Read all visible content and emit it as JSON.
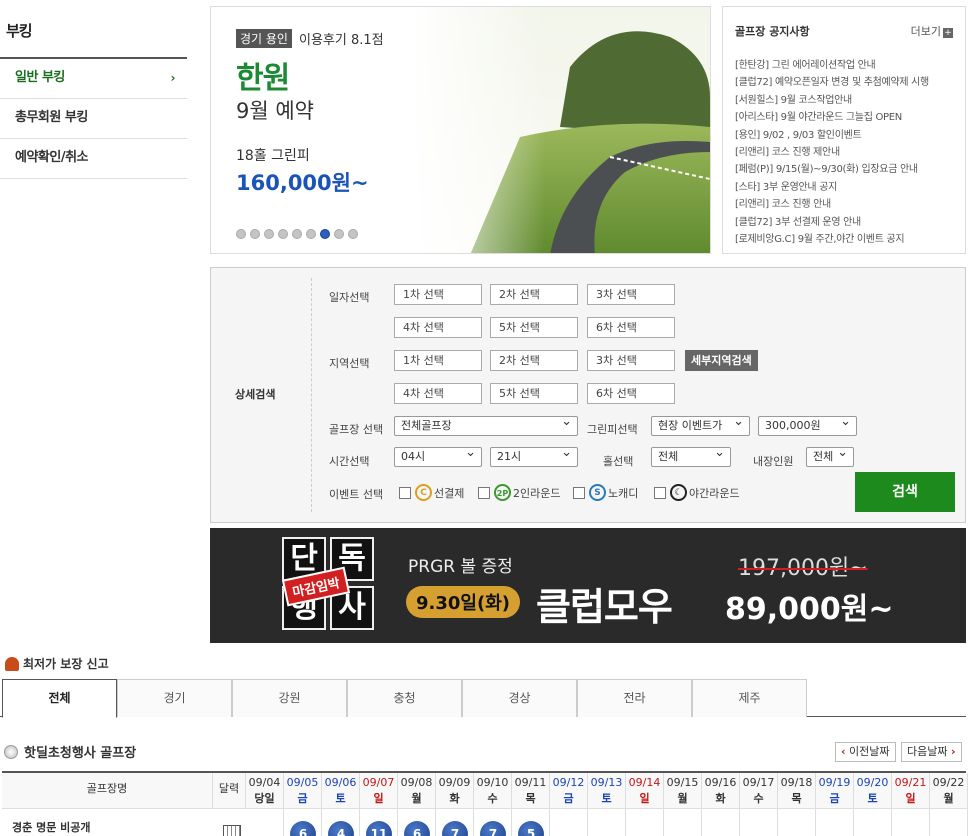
{
  "sidebar": {
    "title": "부킹",
    "items": [
      {
        "label": "일반 부킹",
        "active": true
      },
      {
        "label": "총무회원 부킹",
        "active": false
      },
      {
        "label": "예약확인/취소",
        "active": false
      }
    ]
  },
  "banner": {
    "tag": "경기 용인",
    "rating": "이용후기 8.1점",
    "name": "한원",
    "subtitle": "9월 예약",
    "fee_label": "18홀 그린피",
    "price": "160,000원~",
    "dot_count": 9,
    "active_dot": 6
  },
  "notice": {
    "title": "골프장 공지사항",
    "more": "더보기",
    "items": [
      "[한탄강] 그린 에어레이션작업 안내",
      "[클럽72] 예약오픈일자 변경 및 추첨예약제 시행",
      "[서원힐스] 9월 코스작업안내",
      "[아리스타] 9월 야간라운드 그늘집 OPEN",
      "[용인] 9/02 , 9/03 할인이벤트",
      "[리앤리] 코스 진행 제안내",
      "[페럼(P)] 9/15(월)~9/30(화) 입장요금 안내",
      "[스타] 3부 운영안내 공지",
      "[리앤리] 코스 진행 안내",
      "[클럽72] 3부 선결제 운영 안내",
      "[로제비앙G.C] 9월 주간,야간 이벤트 공지"
    ]
  },
  "search": {
    "main_label": "상세검색",
    "date_label": "일자선택",
    "date_slots": [
      "1차 선택",
      "2차 선택",
      "3차 선택",
      "4차 선택",
      "5차 선택",
      "6차 선택"
    ],
    "region_label": "지역선택",
    "region_slots": [
      "1차 선택",
      "2차 선택",
      "3차 선택",
      "4차 선택",
      "5차 선택",
      "6차 선택"
    ],
    "detail_region_button": "세부지역검색",
    "course_label": "골프장 선택",
    "course_value": "전체골프장",
    "fee_label": "그린피선택",
    "fee_value": "현장 이벤트가",
    "fee_amount": "300,000원",
    "time_label": "시간선택",
    "time_from": "04시",
    "time_to": "21시",
    "hole_label": "홀선택",
    "hole_value": "전체",
    "players_label": "내장인원",
    "players_value": "전체",
    "event_label": "이벤트 선택",
    "events": [
      {
        "icon": "C",
        "label": "선결제",
        "color": "#d9a021"
      },
      {
        "icon": "2P",
        "label": "2인라운드",
        "color": "#3a9a2e"
      },
      {
        "icon": "S",
        "label": "노캐디",
        "color": "#2b7ab8"
      },
      {
        "icon": "☾",
        "label": "야간라운드",
        "color": "#222222"
      }
    ],
    "search_button": "검색"
  },
  "promo": {
    "block_chars": [
      "단",
      "독",
      "행",
      "사"
    ],
    "badge": "마감임박",
    "gift": "PRGR 볼 증정",
    "date": "9.30일(화)",
    "model": "클럽모우",
    "old_price": "197,000원~",
    "new_price": "89,000원~"
  },
  "lowest_price": "최저가 보장 신고",
  "region_tabs": [
    "전체",
    "경기",
    "강원",
    "충청",
    "경상",
    "전라",
    "제주"
  ],
  "hotdeal": {
    "title": "핫딜초청행사 골프장",
    "prev": "이전날짜",
    "next": "다음날짜"
  },
  "calendar": {
    "name_header": "골프장명",
    "cal_header": "달력",
    "days": [
      {
        "date": "09/04",
        "dow": "당일",
        "type": "today"
      },
      {
        "date": "09/05",
        "dow": "금",
        "type": "fri"
      },
      {
        "date": "09/06",
        "dow": "토",
        "type": "sat"
      },
      {
        "date": "09/07",
        "dow": "일",
        "type": "sun"
      },
      {
        "date": "09/08",
        "dow": "월",
        "type": "wk"
      },
      {
        "date": "09/09",
        "dow": "화",
        "type": "wk"
      },
      {
        "date": "09/10",
        "dow": "수",
        "type": "wk"
      },
      {
        "date": "09/11",
        "dow": "목",
        "type": "wk"
      },
      {
        "date": "09/12",
        "dow": "금",
        "type": "fri"
      },
      {
        "date": "09/13",
        "dow": "토",
        "type": "sat"
      },
      {
        "date": "09/14",
        "dow": "일",
        "type": "sun"
      },
      {
        "date": "09/15",
        "dow": "월",
        "type": "wk"
      },
      {
        "date": "09/16",
        "dow": "화",
        "type": "wk"
      },
      {
        "date": "09/17",
        "dow": "수",
        "type": "wk"
      },
      {
        "date": "09/18",
        "dow": "목",
        "type": "wk"
      },
      {
        "date": "09/19",
        "dow": "금",
        "type": "fri"
      },
      {
        "date": "09/20",
        "dow": "토",
        "type": "sat"
      },
      {
        "date": "09/21",
        "dow": "일",
        "type": "sun"
      },
      {
        "date": "09/22",
        "dow": "월",
        "type": "wk"
      }
    ],
    "row_name": "경춘 명문 비공개",
    "row_counts": [
      "6",
      "4",
      "11",
      "6",
      "7",
      "7",
      "5"
    ]
  },
  "colors": {
    "accent_green": "#1c8a1c",
    "price_blue": "#1a54b8",
    "saturday": "#1b43b5",
    "sunday": "#c31515"
  }
}
